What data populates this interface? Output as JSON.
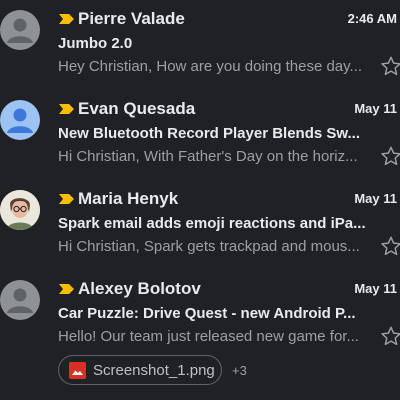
{
  "emails": [
    {
      "sender": "Pierre Valade",
      "date": "2:46 AM",
      "subject": "Jumbo 2.0",
      "snippet": "Hey Christian, How are you doing these day...",
      "avatar": "default-avatar"
    },
    {
      "sender": "Evan Quesada",
      "date": "May 11",
      "subject": "New Bluetooth Record Player Blends Sw...",
      "snippet": "Hi Christian, With Father's Day on the horiz...",
      "avatar": "default-avatar-blue"
    },
    {
      "sender": "Maria Henyk",
      "date": "May 11",
      "subject": "Spark email adds emoji reactions and iPa...",
      "snippet": "Hi Christian, Spark gets trackpad and mous...",
      "avatar": "photo-avatar"
    },
    {
      "sender": "Alexey Bolotov",
      "date": "May 11",
      "subject": "Car Puzzle: Drive Quest - new Android P...",
      "snippet": "Hello! Our team just released new game for...",
      "avatar": "default-avatar",
      "attachment": {
        "name": "Screenshot_1.png",
        "icon": "image-file-icon",
        "more": "+3"
      }
    }
  ],
  "colors": {
    "background": "#202124",
    "important_marker": "#fbbc04",
    "attachment_icon": "#d93025"
  }
}
